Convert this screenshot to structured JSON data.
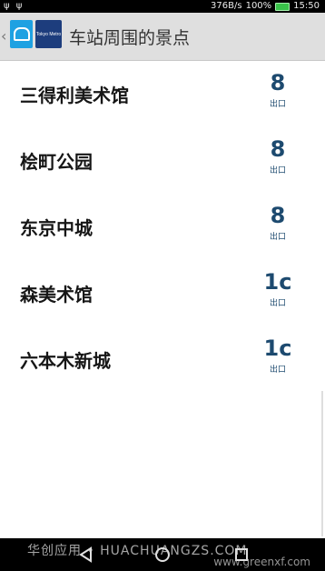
{
  "status_bar": {
    "left_icons": "ψ ψ",
    "speed": "376B/s",
    "battery_text": "100%",
    "time": "15:50"
  },
  "app_bar": {
    "back_icon": "chevron-left-icon",
    "logo_text": "Tokyo Metro",
    "title": "车站周围的景点"
  },
  "list": {
    "exit_label": "出口",
    "items": [
      {
        "name": "三得利美术馆",
        "exit": "8"
      },
      {
        "name": "桧町公园",
        "exit": "8"
      },
      {
        "name": "东京中城",
        "exit": "8"
      },
      {
        "name": "森美术馆",
        "exit": "1c"
      },
      {
        "name": "六本木新城",
        "exit": "1c"
      }
    ]
  },
  "watermark": {
    "left": "华创应用 • HUACHUANGZS.COM",
    "right": "www.greenxf.com"
  }
}
